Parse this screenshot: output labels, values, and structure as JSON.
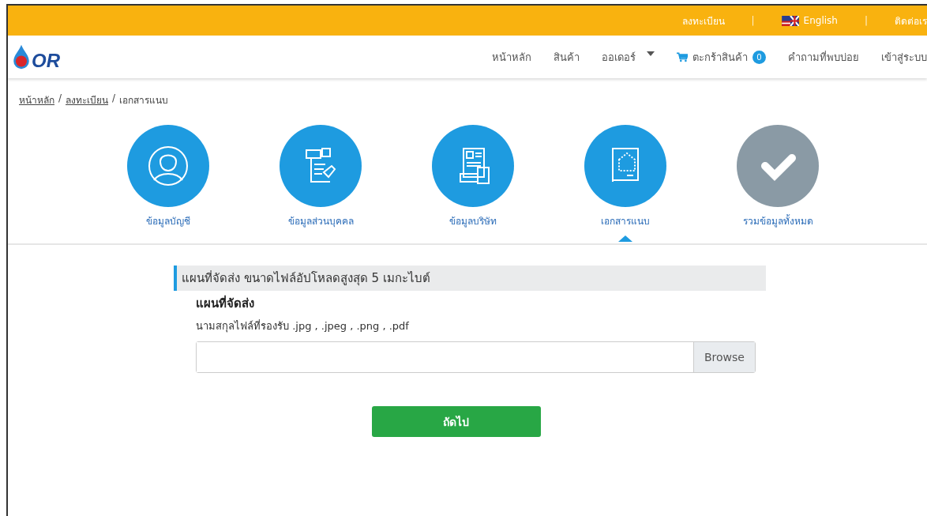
{
  "topbar": {
    "links": [
      {
        "label": "ลงทะเบียน",
        "kind": "text"
      },
      {
        "label": "English",
        "kind": "flag"
      },
      {
        "label": "ติดต่อเร",
        "kind": "text"
      }
    ],
    "separator": "|"
  },
  "logo": {
    "text": "OR"
  },
  "nav": {
    "items": [
      {
        "label": "หน้าหลัก",
        "kind": "text"
      },
      {
        "label": "สินค้า",
        "kind": "text"
      },
      {
        "label": "ออเดอร์",
        "kind": "dropdown"
      },
      {
        "label": "ตะกร้าสินค้า",
        "kind": "cart",
        "badge": "0"
      },
      {
        "label": "คำถามที่พบบ่อย",
        "kind": "text"
      },
      {
        "label": "เข้าสู่ระบบ",
        "kind": "text"
      }
    ]
  },
  "breadcrumb_separator": "/",
  "breadcrumb": [
    {
      "label": "หน้าหลัก",
      "link": true
    },
    {
      "label": "ลงทะเบียน",
      "link": true
    },
    {
      "label": "เอกสารแนบ",
      "link": false
    }
  ],
  "steps": [
    {
      "label": "ข้อมูลบัญชี",
      "kind": "person",
      "active": true,
      "selected": false
    },
    {
      "label": "ข้อมูลส่วนบุคคล",
      "kind": "form",
      "active": true,
      "selected": false
    },
    {
      "label": "ข้อมูลบริษัท",
      "kind": "finance",
      "active": true,
      "selected": false
    },
    {
      "label": "เอกสารแนบ",
      "kind": "plan",
      "active": true,
      "selected": true
    },
    {
      "label": "รวมข้อมูลทั้งหมด",
      "kind": "check",
      "active": false,
      "selected": false
    }
  ],
  "section": {
    "header": "แผนที่จัดส่ง ขนาดไฟล์อัปโหลดสูงสุด 5 เมกะไบต์",
    "title": "แผนที่จัดส่ง",
    "hint": "นามสกุลไฟล์ที่รองรับ .jpg , .jpeg , .png , .pdf",
    "browse": "Browse"
  },
  "next_button": "ถัดไป"
}
